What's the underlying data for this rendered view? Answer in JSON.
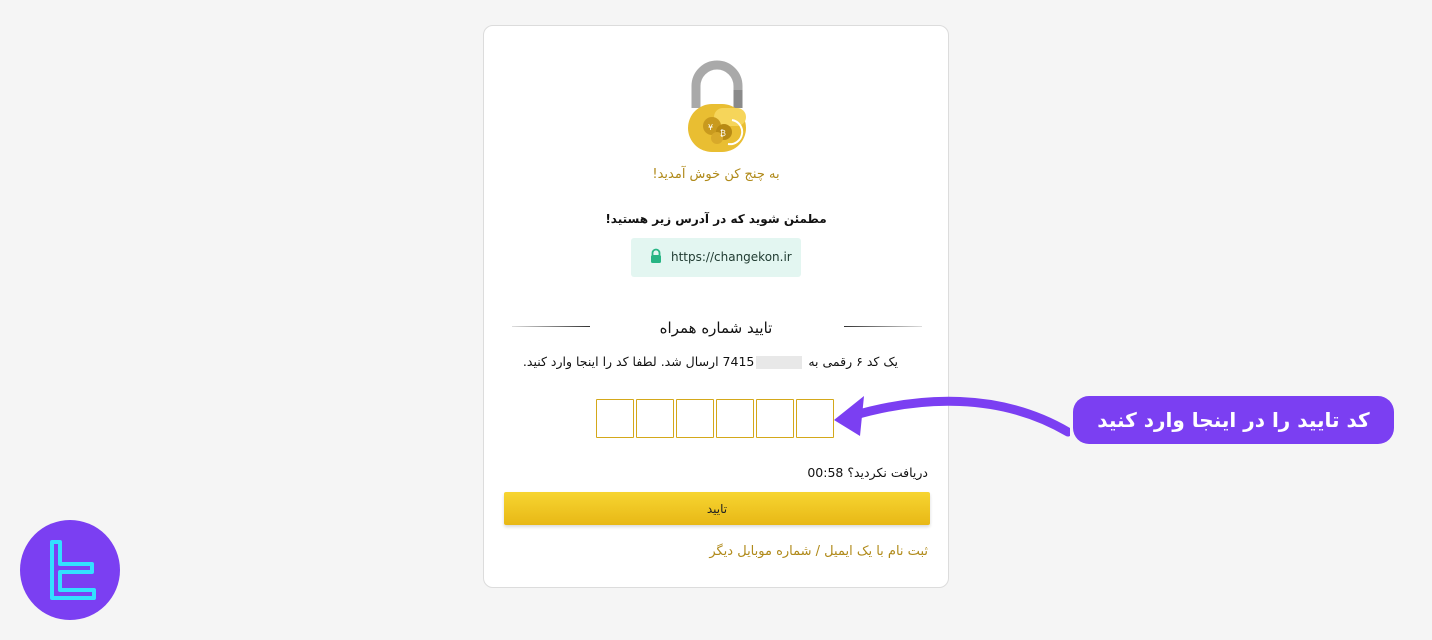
{
  "card": {
    "welcome": "به چنج کن خوش آمدید!",
    "notice": "مطمئن شوید که در آدرس زیر هستید!",
    "url": "https://changekon.ir",
    "section_title": "تایید شماره همراه",
    "sent_msg_before": "یک کد ۶ رقمی به",
    "phone_visible": "7415",
    "sent_msg_after": "ارسال شد. لطفا کد را اینجا وارد کنید.",
    "code_length": 6,
    "resend_label": "دریافت نکردید؟",
    "countdown": "00:58",
    "confirm_label": "تایید",
    "alt_register": "ثبت نام با یک ایمیل / شماره موبایل دیگر"
  },
  "annotation": {
    "callout": "کد تایید را در اینجا وارد کنید"
  },
  "icons": {
    "lock": "padlock-bitcoin-icon",
    "url_lock": "lock-icon",
    "arrow": "arrow-left-icon",
    "logo": "brand-logo"
  },
  "colors": {
    "accent_gold": "#b08a1a",
    "button_yellow": "#f2c92a",
    "callout_purple": "#7b3ff2",
    "url_bg": "#e3f6f1"
  }
}
